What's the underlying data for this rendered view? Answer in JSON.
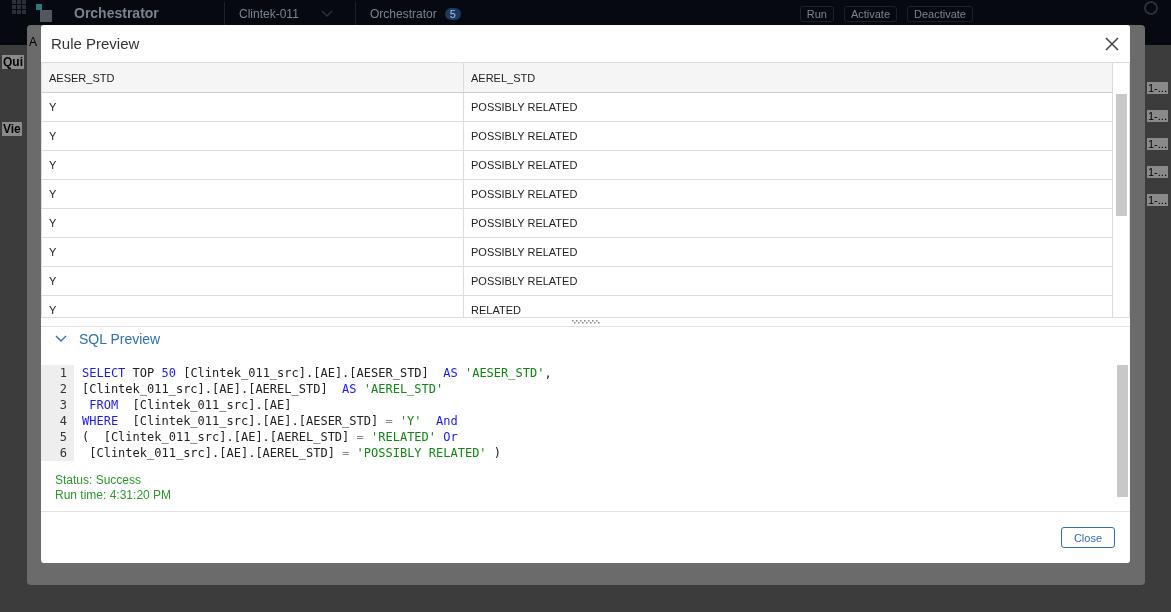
{
  "app_bar": {
    "brand": "Orchestrator",
    "selectors": [
      {
        "label": "Clintek-011"
      },
      {
        "label": "Orchestrator",
        "count": "5"
      }
    ],
    "actions": [
      "Run",
      "Activate",
      "Deactivate"
    ]
  },
  "background": {
    "sidebar_fragments": [
      "Qui",
      "Vie"
    ],
    "back_dialog_fragment": "A",
    "list_fragments": [
      "1-...",
      "1-...",
      "1-...",
      "1-...",
      "1-..."
    ]
  },
  "dialog": {
    "title": "Rule Preview",
    "table": {
      "columns": [
        "AESER_STD",
        "AEREL_STD"
      ],
      "rows": [
        [
          "Y",
          "POSSIBLY RELATED"
        ],
        [
          "Y",
          "POSSIBLY RELATED"
        ],
        [
          "Y",
          "POSSIBLY RELATED"
        ],
        [
          "Y",
          "POSSIBLY RELATED"
        ],
        [
          "Y",
          "POSSIBLY RELATED"
        ],
        [
          "Y",
          "POSSIBLY RELATED"
        ],
        [
          "Y",
          "POSSIBLY RELATED"
        ],
        [
          "Y",
          "RELATED"
        ]
      ]
    },
    "sql_preview": {
      "title": "SQL Preview",
      "expanded": true,
      "lines": [
        {
          "number": "1",
          "tokens": [
            {
              "kind": "keyword",
              "text": "SELECT"
            },
            {
              "kind": "plain",
              "text": " TOP "
            },
            {
              "kind": "number",
              "text": "50"
            },
            {
              "kind": "plain",
              "text": " [Clintek_011_src].[AE].[AESER_STD]  "
            },
            {
              "kind": "keyword",
              "text": "AS"
            },
            {
              "kind": "string",
              "text": " 'AESER_STD'"
            },
            {
              "kind": "plain",
              "text": ","
            }
          ]
        },
        {
          "number": "2",
          "tokens": [
            {
              "kind": "plain",
              "text": "[Clintek_011_src].[AE].[AEREL_STD]  "
            },
            {
              "kind": "keyword",
              "text": "AS"
            },
            {
              "kind": "string",
              "text": " 'AEREL_STD'"
            }
          ]
        },
        {
          "number": "3",
          "tokens": [
            {
              "kind": "keyword",
              "text": " FROM"
            },
            {
              "kind": "plain",
              "text": "  [Clintek_011_src].[AE]"
            }
          ]
        },
        {
          "number": "4",
          "tokens": [
            {
              "kind": "keyword",
              "text": "WHERE"
            },
            {
              "kind": "plain",
              "text": "  [Clintek_011_src].[AE].[AESER_STD] "
            },
            {
              "kind": "operator",
              "text": "="
            },
            {
              "kind": "string",
              "text": " 'Y'"
            },
            {
              "kind": "keyword",
              "text": "  And"
            }
          ]
        },
        {
          "number": "5",
          "tokens": [
            {
              "kind": "plain",
              "text": "(  [Clintek_011_src].[AE].[AEREL_STD] "
            },
            {
              "kind": "operator",
              "text": "="
            },
            {
              "kind": "string",
              "text": " 'RELATED'"
            },
            {
              "kind": "keyword",
              "text": " Or"
            }
          ]
        },
        {
          "number": "6",
          "tokens": [
            {
              "kind": "plain",
              "text": " [Clintek_011_src].[AE].[AEREL_STD] "
            },
            {
              "kind": "operator",
              "text": "="
            },
            {
              "kind": "string",
              "text": " 'POSSIBLY RELATED'"
            },
            {
              "kind": "plain",
              "text": " )"
            }
          ]
        }
      ],
      "status": "Status: Success",
      "run_time": "Run time: 4:31:20 PM"
    },
    "buttons": [
      "Close"
    ]
  }
}
